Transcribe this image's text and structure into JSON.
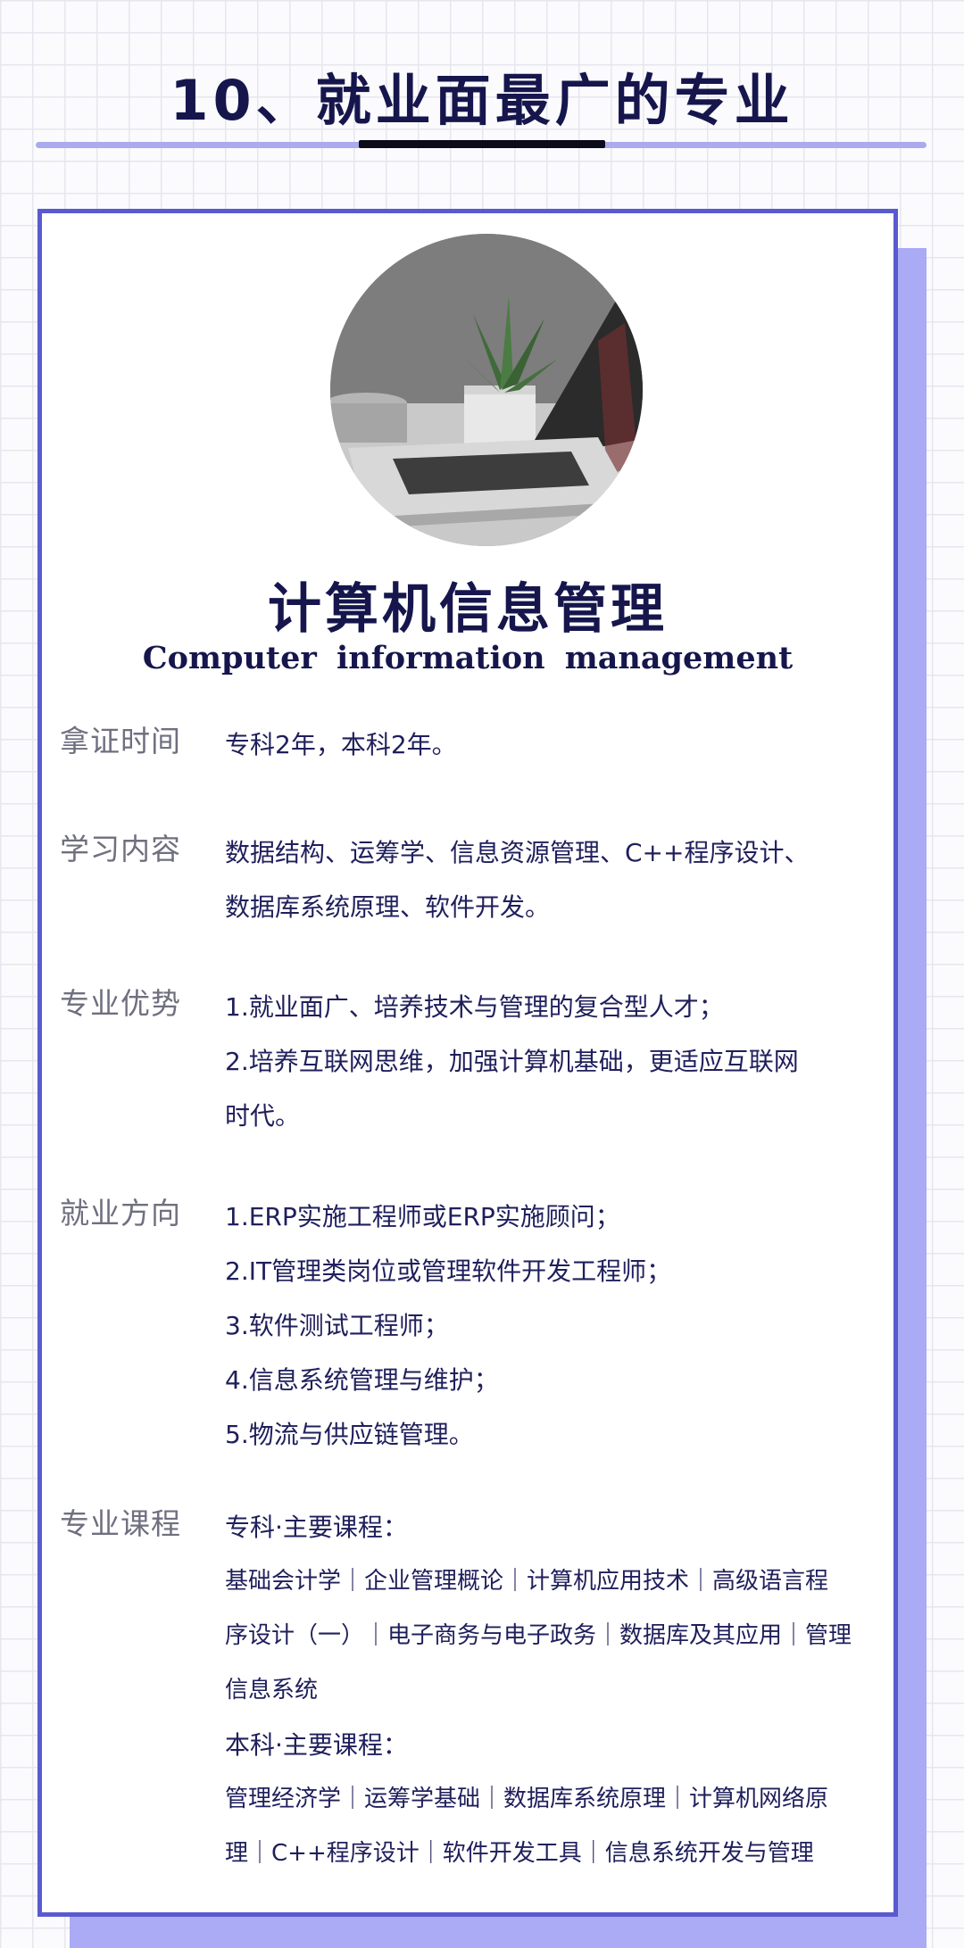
{
  "header": {
    "title": "10、就业面最广的专业"
  },
  "major": {
    "title": "计算机信息管理",
    "subtitle": "Computer information management"
  },
  "sections": {
    "cert_time": {
      "label": "拿证时间",
      "lines": [
        "专科2年，本科2年。"
      ]
    },
    "study": {
      "label": "学习内容",
      "lines": [
        "数据结构、运筹学、信息资源管理、C++程序设计、",
        "数据库系统原理、软件开发。"
      ]
    },
    "advantage": {
      "label": "专业优势",
      "lines": [
        "1.就业面广、培养技术与管理的复合型人才；",
        "2.培养互联网思维，加强计算机基础，更适应互联网",
        "时代。"
      ]
    },
    "career": {
      "label": "就业方向",
      "lines": [
        "1.ERP实施工程师或ERP实施顾问；",
        "2.IT管理类岗位或管理软件开发工程师；",
        "3.软件测试工程师；",
        "4.信息系统管理与维护；",
        "5.物流与供应链管理。"
      ]
    },
    "courses": {
      "label": "专业课程",
      "junior_title": "专科·主要课程：",
      "junior_lines": [
        "基础会计学｜企业管理概论｜计算机应用技术｜高级语言程",
        "序设计（一）｜电子商务与电子政务｜数据库及其应用｜管理",
        "信息系统"
      ],
      "senior_title": "本科·主要课程：",
      "senior_lines": [
        "管理经济学｜运筹学基础｜数据库系统原理｜计算机网络原",
        "理｜C++程序设计｜软件开发工具｜信息系统开发与管理"
      ]
    }
  },
  "colors": {
    "accent": "#5a5acf",
    "shadow": "#aaaaf5",
    "title": "#16164d",
    "label": "#6f6f7f"
  },
  "icons": {
    "photo": "laptop-plant-photo"
  }
}
